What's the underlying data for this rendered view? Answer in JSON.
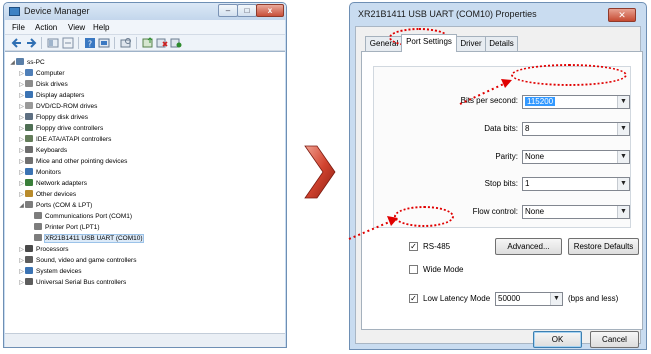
{
  "device_manager": {
    "title": "Device Manager",
    "menu": [
      "File",
      "Action",
      "View",
      "Help"
    ],
    "tree": [
      {
        "label": "ss-PC",
        "depth": 0,
        "arrow": "◢",
        "icon": "computer-icon",
        "color": "#5a7fa8"
      },
      {
        "label": "Computer",
        "depth": 1,
        "arrow": "▷",
        "icon": "computer-icon",
        "color": "#4f7fb8"
      },
      {
        "label": "Disk drives",
        "depth": 1,
        "arrow": "▷",
        "icon": "disk-icon",
        "color": "#8c8c8c"
      },
      {
        "label": "Display adapters",
        "depth": 1,
        "arrow": "▷",
        "icon": "monitor-icon",
        "color": "#3b73b3"
      },
      {
        "label": "DVD/CD-ROM drives",
        "depth": 1,
        "arrow": "▷",
        "icon": "dvd-icon",
        "color": "#9a9a9a"
      },
      {
        "label": "Floppy disk drives",
        "depth": 1,
        "arrow": "▷",
        "icon": "floppy-icon",
        "color": "#5e6f82"
      },
      {
        "label": "Floppy drive controllers",
        "depth": 1,
        "arrow": "▷",
        "icon": "controller-icon",
        "color": "#4f6f54"
      },
      {
        "label": "IDE ATA/ATAPI controllers",
        "depth": 1,
        "arrow": "▷",
        "icon": "controller-icon",
        "color": "#647d5a"
      },
      {
        "label": "Keyboards",
        "depth": 1,
        "arrow": "▷",
        "icon": "keyboard-icon",
        "color": "#6d6d6d"
      },
      {
        "label": "Mice and other pointing devices",
        "depth": 1,
        "arrow": "▷",
        "icon": "mouse-icon",
        "color": "#707070"
      },
      {
        "label": "Monitors",
        "depth": 1,
        "arrow": "▷",
        "icon": "monitor-icon",
        "color": "#3b73b3"
      },
      {
        "label": "Network adapters",
        "depth": 1,
        "arrow": "▷",
        "icon": "network-icon",
        "color": "#3a7f3a"
      },
      {
        "label": "Other devices",
        "depth": 1,
        "arrow": "▷",
        "icon": "unknown-device-icon",
        "color": "#b98b2b"
      },
      {
        "label": "Ports (COM & LPT)",
        "depth": 1,
        "arrow": "◢",
        "icon": "port-icon",
        "color": "#7d7d7d"
      },
      {
        "label": "Communications Port (COM1)",
        "depth": 2,
        "arrow": "",
        "icon": "port-icon",
        "color": "#7d7d7d"
      },
      {
        "label": "Printer Port (LPT1)",
        "depth": 2,
        "arrow": "",
        "icon": "port-icon",
        "color": "#7d7d7d"
      },
      {
        "label": "XR21B1411 USB UART (COM10)",
        "depth": 2,
        "arrow": "",
        "icon": "port-icon",
        "color": "#7d7d7d",
        "selected": true
      },
      {
        "label": "Processors",
        "depth": 1,
        "arrow": "▷",
        "icon": "chip-icon",
        "color": "#4a4a4a"
      },
      {
        "label": "Sound, video and game controllers",
        "depth": 1,
        "arrow": "▷",
        "icon": "speaker-icon",
        "color": "#5d5d5d"
      },
      {
        "label": "System devices",
        "depth": 1,
        "arrow": "▷",
        "icon": "system-icon",
        "color": "#3b73b3"
      },
      {
        "label": "Universal Serial Bus controllers",
        "depth": 1,
        "arrow": "▷",
        "icon": "usb-icon",
        "color": "#5d5d5d"
      }
    ]
  },
  "properties": {
    "title": "XR21B1411 USB UART (COM10) Properties",
    "close_label": "✕",
    "tabs": [
      "General",
      "Port Settings",
      "Driver",
      "Details"
    ],
    "active_tab": "Port Settings",
    "fields": {
      "bits_per_second": {
        "label": "Bits per second:",
        "value": "115200"
      },
      "data_bits": {
        "label": "Data bits:",
        "value": "8"
      },
      "parity": {
        "label": "Parity:",
        "value": "None"
      },
      "stop_bits": {
        "label": "Stop bits:",
        "value": "1"
      },
      "flow_control": {
        "label": "Flow control:",
        "value": "None"
      }
    },
    "rs485": {
      "label": "RS-485",
      "checked": true
    },
    "wide_mode": {
      "label": "Wide Mode",
      "checked": false
    },
    "low_latency": {
      "label": "Low Latency Mode",
      "checked": true,
      "value": "50000",
      "suffix": "(bps and less)"
    },
    "buttons": {
      "advanced": "Advanced...",
      "restore": "Restore Defaults",
      "ok": "OK",
      "cancel": "Cancel"
    }
  },
  "annotation_color": "#e00000",
  "arrow_color": "#c0392b"
}
